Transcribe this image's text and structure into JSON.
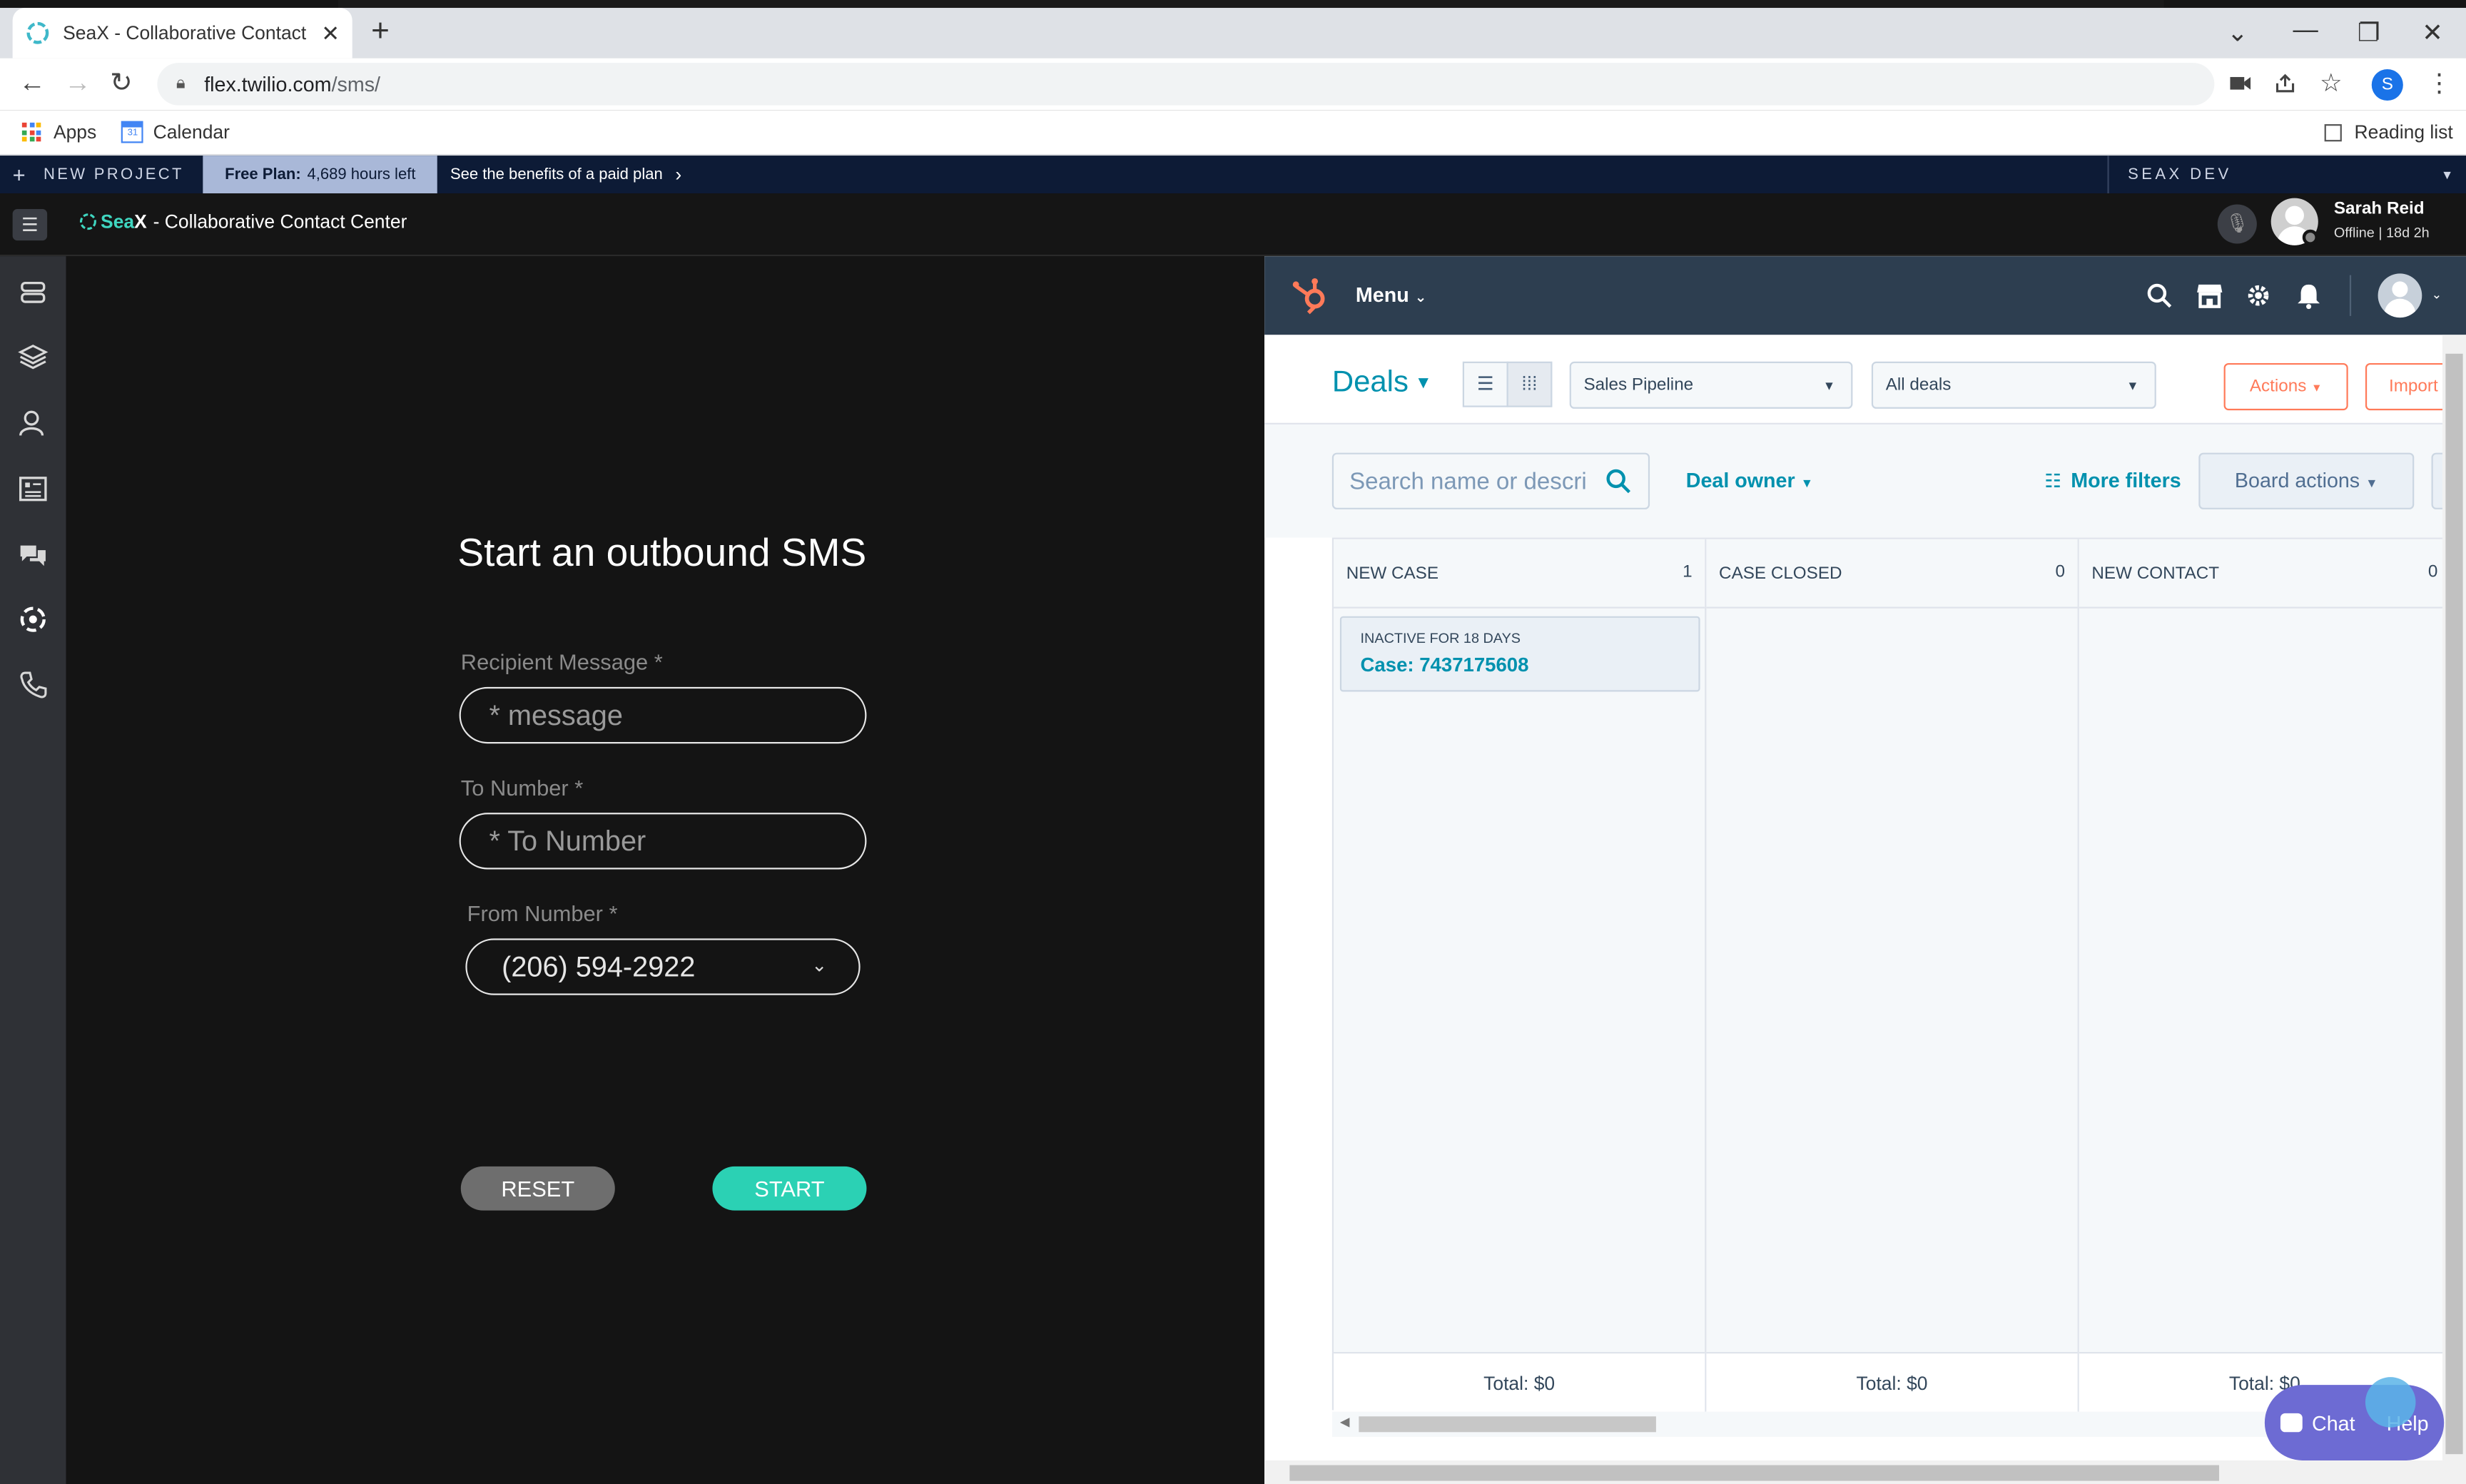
{
  "browser": {
    "tab_title": "SeaX - Collaborative Contact Cen",
    "url_host": "flex.twilio.com",
    "url_path": "/sms/",
    "profile_initial": "S",
    "bookmarks": {
      "apps": "Apps",
      "calendar": "Calendar",
      "reading_list": "Reading list"
    }
  },
  "twilio_bar": {
    "new_project": "NEW PROJECT",
    "free_plan_label": "Free Plan:",
    "free_plan_hours": "4,689 hours left",
    "benefits": "See the benefits of a paid plan",
    "account": "SEAX DEV"
  },
  "flex_header": {
    "brand_sea": "Sea",
    "brand_x": "X",
    "brand_rest": "- Collaborative Contact Center",
    "user_name": "Sarah Reid",
    "user_status": "Offline | 18d 2h"
  },
  "sms_form": {
    "title": "Start an outbound SMS",
    "recipient_label": "Recipient Message *",
    "recipient_placeholder": "* message",
    "to_label": "To Number *",
    "to_placeholder": "* To Number",
    "from_label": "From Number *",
    "from_value": "(206) 594-2922",
    "reset": "RESET",
    "start": "START"
  },
  "hubspot": {
    "menu": "Menu",
    "deals_title": "Deals",
    "pipeline": "Sales Pipeline",
    "deals_filter": "All deals",
    "actions": "Actions",
    "import": "Import",
    "search_placeholder": "Search name or descri",
    "deal_owner": "Deal owner",
    "more_filters": "More filters",
    "board_actions": "Board actions",
    "columns": [
      {
        "name": "NEW CASE",
        "count": "1",
        "total": "Total: $0"
      },
      {
        "name": "CASE CLOSED",
        "count": "0",
        "total": "Total: $0"
      },
      {
        "name": "NEW CONTACT",
        "count": "0",
        "total": "Total: $0"
      }
    ],
    "card": {
      "tag": "INACTIVE FOR 18 DAYS",
      "title": "Case: 7437175608"
    },
    "chat": "Chat",
    "help": "Help"
  },
  "colors": {
    "accent_teal": "#2bd1b4",
    "hubspot_orange": "#ff7a59",
    "hubspot_link": "#0091ae",
    "twilio_navy": "#0d1b36"
  }
}
